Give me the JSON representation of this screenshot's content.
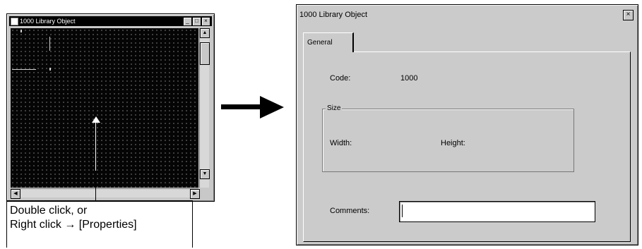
{
  "left_window": {
    "title": "1000 Library Object"
  },
  "callout": {
    "line1": "Double click, or",
    "line2": "Right click → [Properties]"
  },
  "dialog": {
    "title": "1000 Library Object",
    "close_glyph": "×",
    "tab_label": "General",
    "code_label": "Code:",
    "code_value": "1000",
    "size_group_label": "Size",
    "width_label": "Width:",
    "height_label": "Height:",
    "comments_label": "Comments:",
    "comments_value": ""
  },
  "icons": {
    "minimize": "minimize-icon",
    "maximize": "maximize-icon",
    "close": "close-icon",
    "arrow": "right-arrow-icon"
  }
}
